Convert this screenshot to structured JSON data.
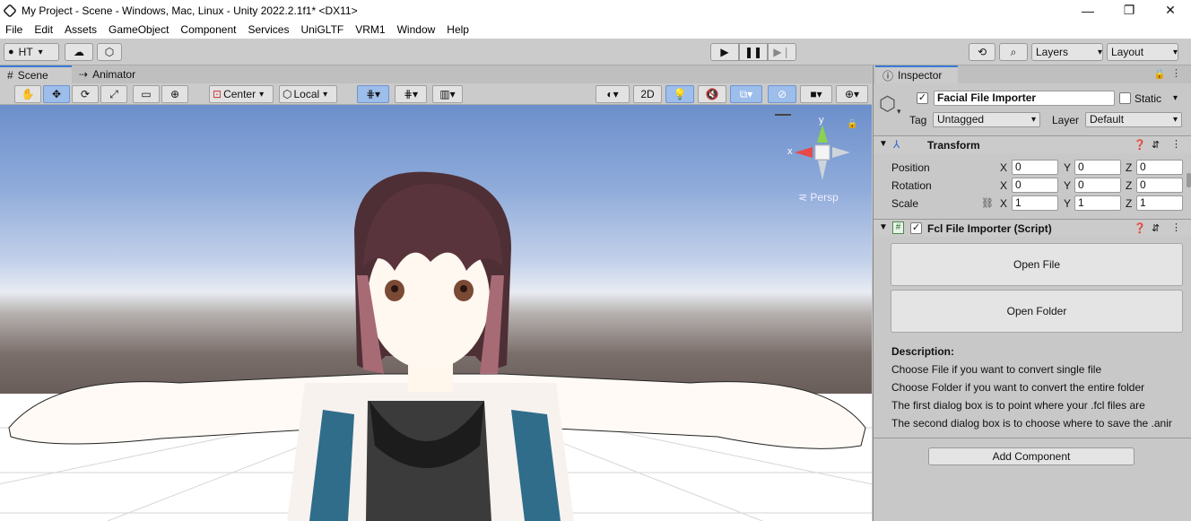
{
  "window": {
    "title": "My Project - Scene - Windows, Mac, Linux - Unity 2022.2.1f1* <DX11>",
    "controls": [
      "—",
      "❐",
      "✕"
    ]
  },
  "menu": [
    "File",
    "Edit",
    "Assets",
    "GameObject",
    "Component",
    "Services",
    "UniGLTF",
    "VRM1",
    "Window",
    "Help"
  ],
  "toolbar": {
    "account": "HT",
    "layers": "Layers",
    "layout": "Layout"
  },
  "scene": {
    "tabs": [
      "Scene",
      "Animator"
    ],
    "pivot": "Center",
    "space": "Local",
    "mode_2d": "2D",
    "gizmo_label": "Persp",
    "axis_y": "y",
    "axis_x": "x"
  },
  "inspector": {
    "tab": "Inspector",
    "object_name": "Facial File Importer",
    "static_label": "Static",
    "tag_label": "Tag",
    "tag_value": "Untagged",
    "layer_label": "Layer",
    "layer_value": "Default",
    "transform": {
      "title": "Transform",
      "position_label": "Position",
      "rotation_label": "Rotation",
      "scale_label": "Scale",
      "x": "X",
      "y": "Y",
      "z": "Z",
      "position": [
        "0",
        "0",
        "0"
      ],
      "rotation": [
        "0",
        "0",
        "0"
      ],
      "scale": [
        "1",
        "1",
        "1"
      ]
    },
    "script": {
      "title": "Fcl File Importer (Script)",
      "open_file": "Open File",
      "open_folder": "Open Folder",
      "description_title": "Description:",
      "lines": [
        "Choose File if you want to convert single file",
        "Choose Folder if you want to convert the entire folder",
        "The first dialog box is to point where your .fcl files are",
        "The second dialog box is to choose where to save the .anir"
      ]
    },
    "add_component": "Add Component"
  }
}
